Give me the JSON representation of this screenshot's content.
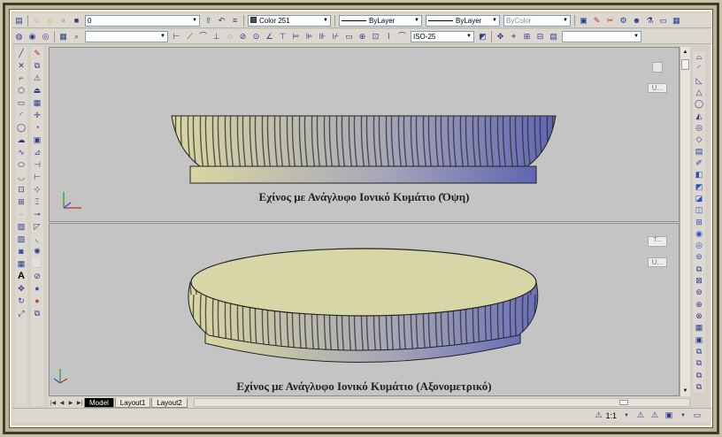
{
  "toolbar": {
    "layer_value": "0",
    "color_value": "Color 251",
    "linetype_value": "ByLayer",
    "lineweight_value": "ByLayer",
    "plotstyle_value": "ByColor",
    "dimstyle_value": "ISO-25",
    "row2_empty_combo": "",
    "row2_right_combo": ""
  },
  "viewports": {
    "top_caption": "Εχίνος με Ανάγλυφο Ιονικό Κυμάτιο (Όψη)",
    "bottom_caption": "Εχίνος με Ανάγλυφο Ιονικό Κυμάτιο (Αξονομετρικό)",
    "viewcube_label": "U...",
    "viewcube_top_face": "",
    "viewcube_bottom_face": "T..."
  },
  "tabs": [
    {
      "label": "Model",
      "active": true
    },
    {
      "label": "Layout1",
      "active": false
    },
    {
      "label": "Layout2",
      "active": false
    }
  ],
  "status": {
    "annotation_scale": "1:1"
  },
  "colors": {
    "bowl_yellow": "#d9d7a0",
    "bowl_blue": "#6a70b8",
    "viewport_bg": "#c4c4c4",
    "frame": "#bdb597"
  }
}
